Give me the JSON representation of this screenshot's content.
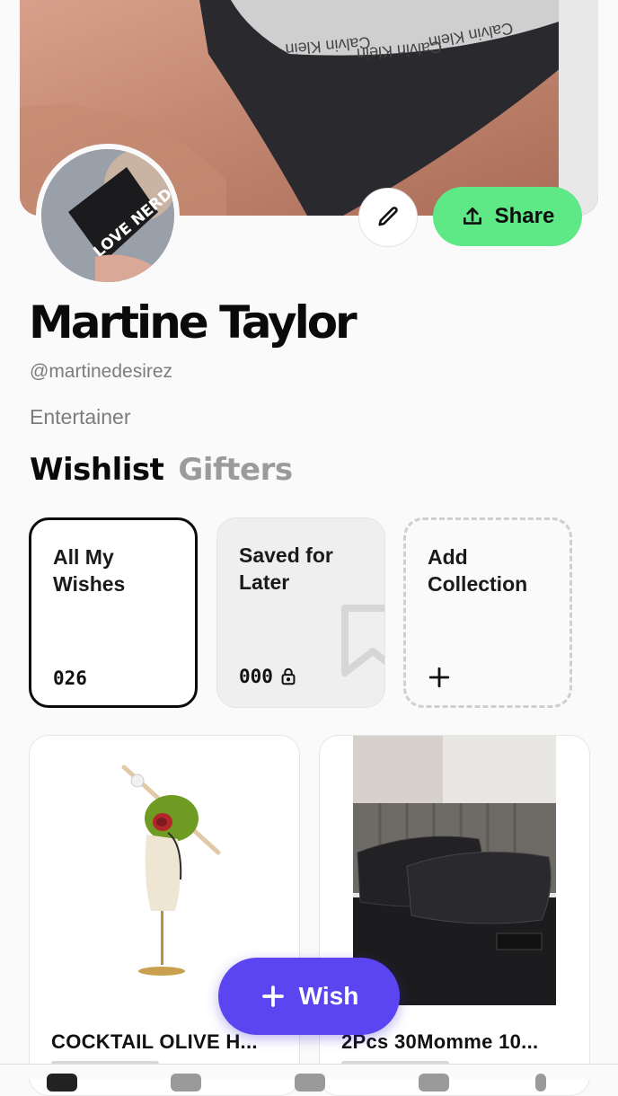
{
  "profile": {
    "name": "Martine Taylor",
    "handle": "@martinedesirez",
    "bio": "Entertainer",
    "avatar_text": "LOVE NERDS"
  },
  "header": {
    "share_label": "Share"
  },
  "tabs": [
    {
      "label": "Wishlist",
      "active": true
    },
    {
      "label": "Gifters",
      "active": false
    }
  ],
  "collections": [
    {
      "title": "All My Wishes",
      "count": "026",
      "locked": false
    },
    {
      "title": "Saved for Later",
      "count": "000",
      "locked": true
    },
    {
      "title": "Add Collection",
      "count": "",
      "locked": false
    }
  ],
  "products": [
    {
      "title": "COCKTAIL OLIVE H..."
    },
    {
      "title": "2Pcs 30Momme 10..."
    }
  ],
  "fab": {
    "label": "Wish"
  },
  "cover_text": [
    "Calvin Klein",
    "Calvin Klein",
    "Calvin Klein"
  ],
  "colors": {
    "share_green": "#5ee886",
    "wish_purple": "#5a45f0",
    "muted": "#7c7c7c"
  }
}
